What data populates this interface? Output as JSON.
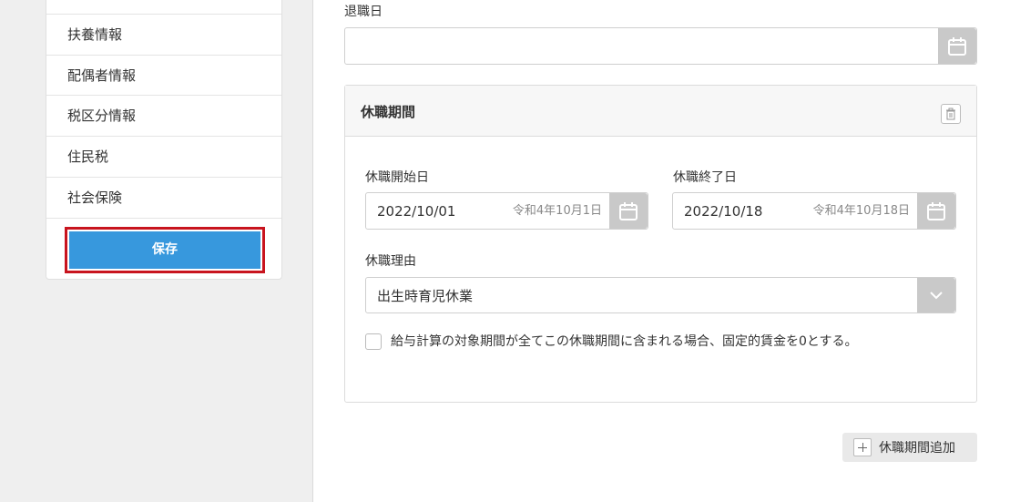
{
  "sidebar": {
    "items": [
      {
        "label": "扶養情報"
      },
      {
        "label": "配偶者情報"
      },
      {
        "label": "税区分情報"
      },
      {
        "label": "住民税"
      },
      {
        "label": "社会保険"
      }
    ],
    "save_label": "保存"
  },
  "main": {
    "retirement": {
      "label": "退職日",
      "value": ""
    },
    "leave": {
      "title": "休職期間",
      "start": {
        "label": "休職開始日",
        "value": "2022/10/01",
        "wareki": "令和4年10月1日"
      },
      "end": {
        "label": "休職終了日",
        "value": "2022/10/18",
        "wareki": "令和4年10月18日"
      },
      "reason": {
        "label": "休職理由",
        "value": "出生時育児休業"
      },
      "checkbox_label": "給与計算の対象期間が全てこの休職期間に含まれる場合、固定的賃金を0とする。",
      "checkbox_checked": false
    },
    "add_period_label": "休職期間追加"
  },
  "colors": {
    "accent": "#3798dd",
    "highlight_border": "#c8141e",
    "calendar_button": "#c9c9c9"
  }
}
